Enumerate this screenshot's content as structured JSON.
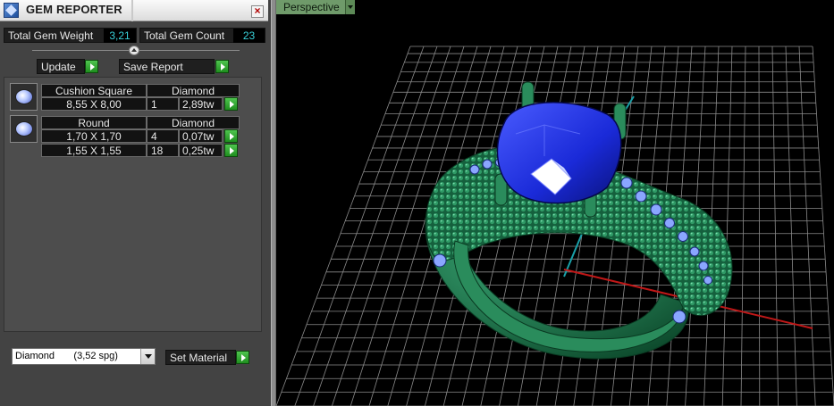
{
  "window": {
    "title": "GEM REPORTER",
    "close_symbol": "×"
  },
  "totals": {
    "weight_label": "Total Gem Weight",
    "weight_value": "3,21",
    "count_label": "Total Gem Count",
    "count_value": "23"
  },
  "actions": {
    "update_label": "Update",
    "save_label": "Save Report"
  },
  "gem_groups": [
    {
      "shape": "Cushion Square",
      "material": "Diamond",
      "rows": [
        {
          "size": "8,55 X 8,00",
          "count": "1",
          "weight": "2,89tw"
        }
      ]
    },
    {
      "shape": "Round",
      "material": "Diamond",
      "rows": [
        {
          "size": "1,70 X 1,70",
          "count": "4",
          "weight": "0,07tw"
        },
        {
          "size": "1,55 X 1,55",
          "count": "18",
          "weight": "0,25tw"
        }
      ]
    }
  ],
  "material_select": {
    "value": "Diamond       (3,52 spg)"
  },
  "set_material_label": "Set Material",
  "viewport": {
    "tab_label": "Perspective"
  },
  "colors": {
    "ring_green": "#1f7a4f",
    "gem_blue": "#1f2fc8",
    "grid": "#8a8a8a",
    "x_axis": "#c01818",
    "y_axis": "#1aa0a8"
  },
  "icons": [
    "app-icon",
    "close-icon",
    "collapse-icon",
    "play-arrow-icon",
    "dropdown-arrow-icon",
    "gem-thumbnail-icon"
  ]
}
